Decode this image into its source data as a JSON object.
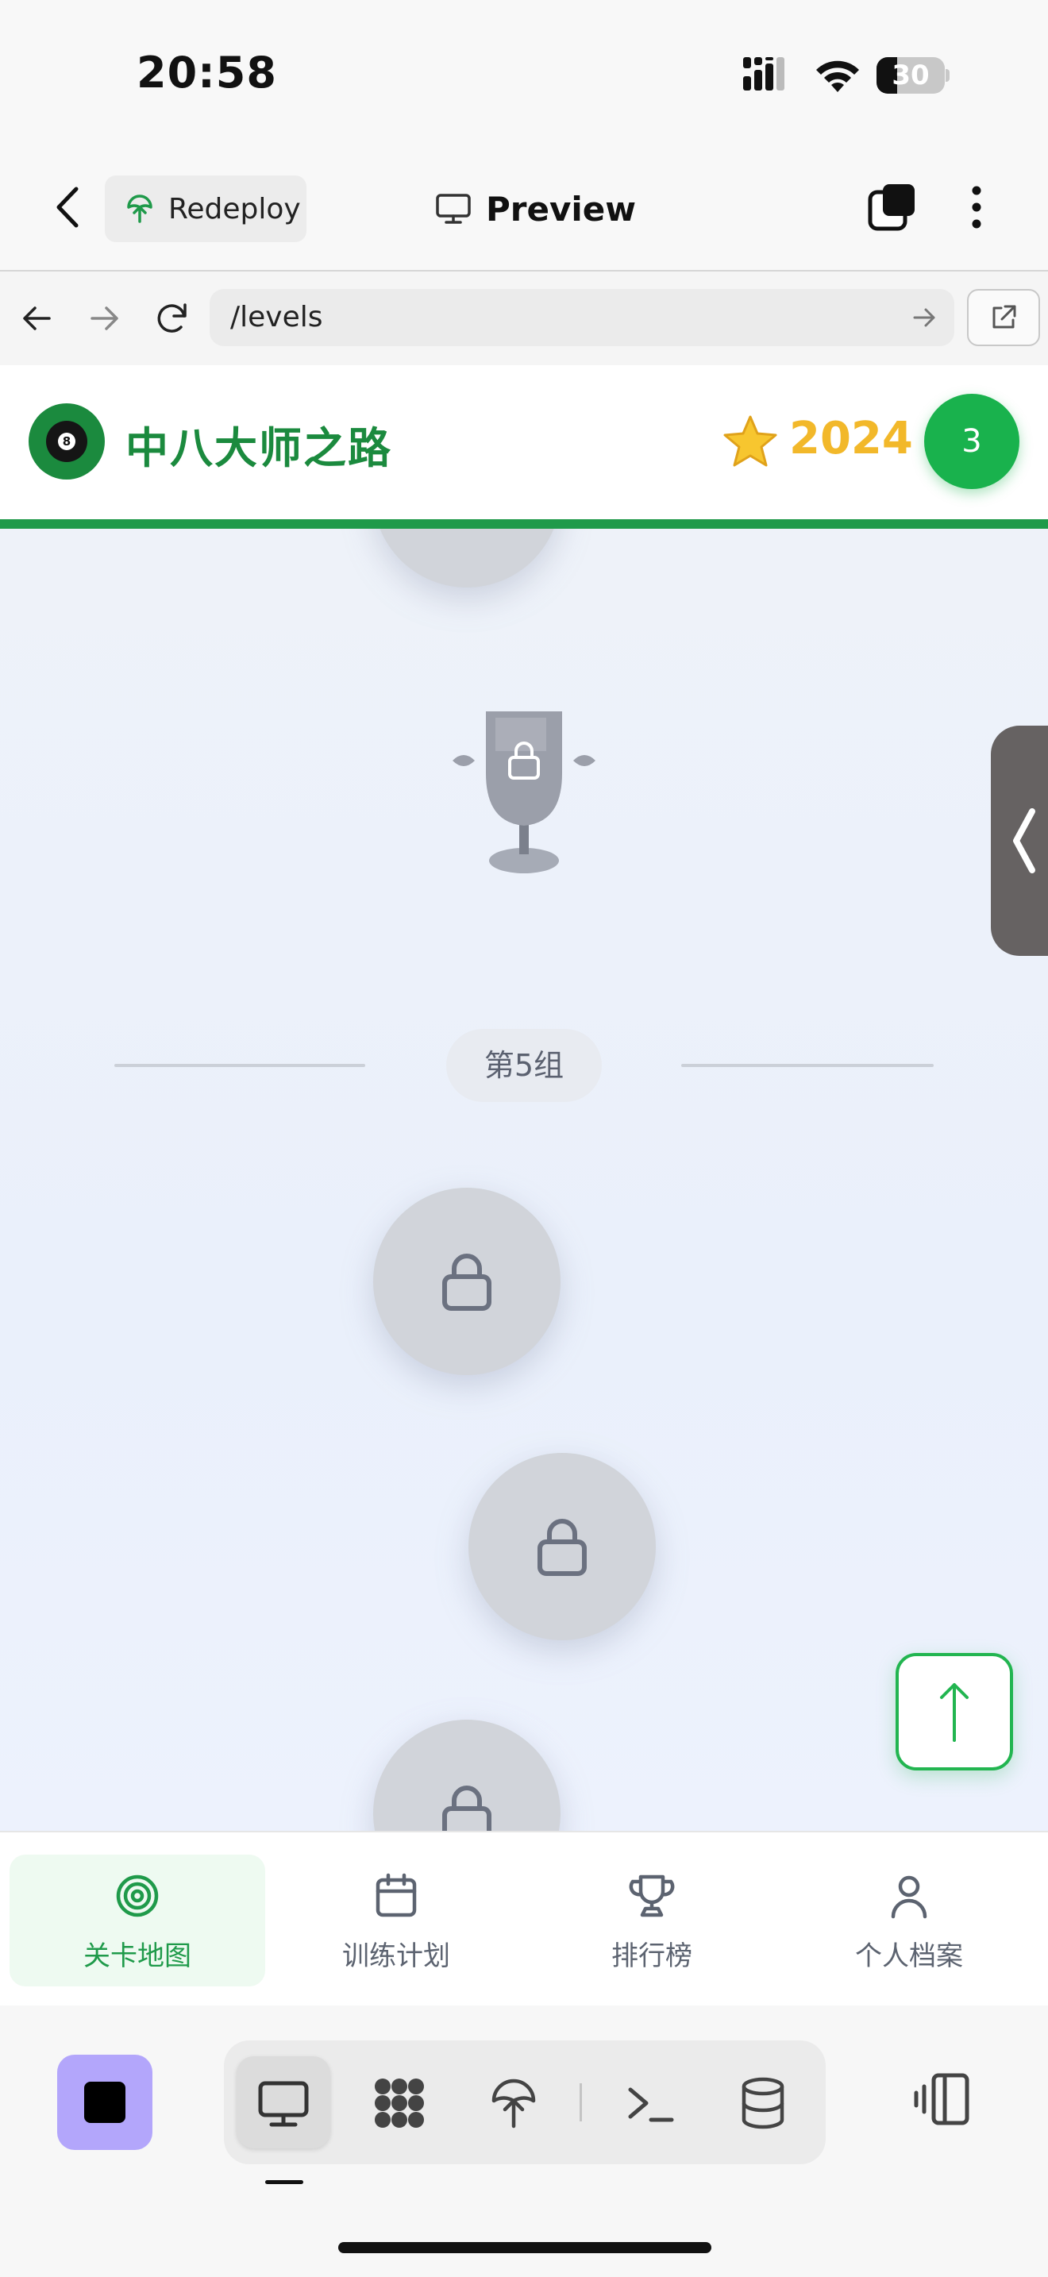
{
  "status_bar": {
    "time": "20:58",
    "battery": "30",
    "battery_fraction": 0.3
  },
  "app_header": {
    "redeploy_label": "Redeploy",
    "preview_label": "Preview"
  },
  "browser": {
    "url": "/levels"
  },
  "game_header": {
    "title": "中八大师之路",
    "score": "2024",
    "level": "3"
  },
  "map": {
    "group_label": "第5组"
  },
  "bottom_nav": {
    "items": [
      {
        "label": "关卡地图",
        "icon": "target-icon",
        "active": true
      },
      {
        "label": "训练计划",
        "icon": "calendar-icon",
        "active": false
      },
      {
        "label": "排行榜",
        "icon": "trophy-icon",
        "active": false
      },
      {
        "label": "个人档案",
        "icon": "user-icon",
        "active": false
      }
    ]
  },
  "dev_toolbar": {
    "tools": [
      "monitor-icon",
      "grid-icon",
      "deploy-icon",
      "terminal-icon",
      "database-icon"
    ],
    "active_tool": "monitor-icon"
  },
  "colors": {
    "brand_green": "#1f9a4a",
    "score_gold": "#f2b82a",
    "locked_node": "#d1d4da",
    "stop_button": "#b3a6fb"
  }
}
